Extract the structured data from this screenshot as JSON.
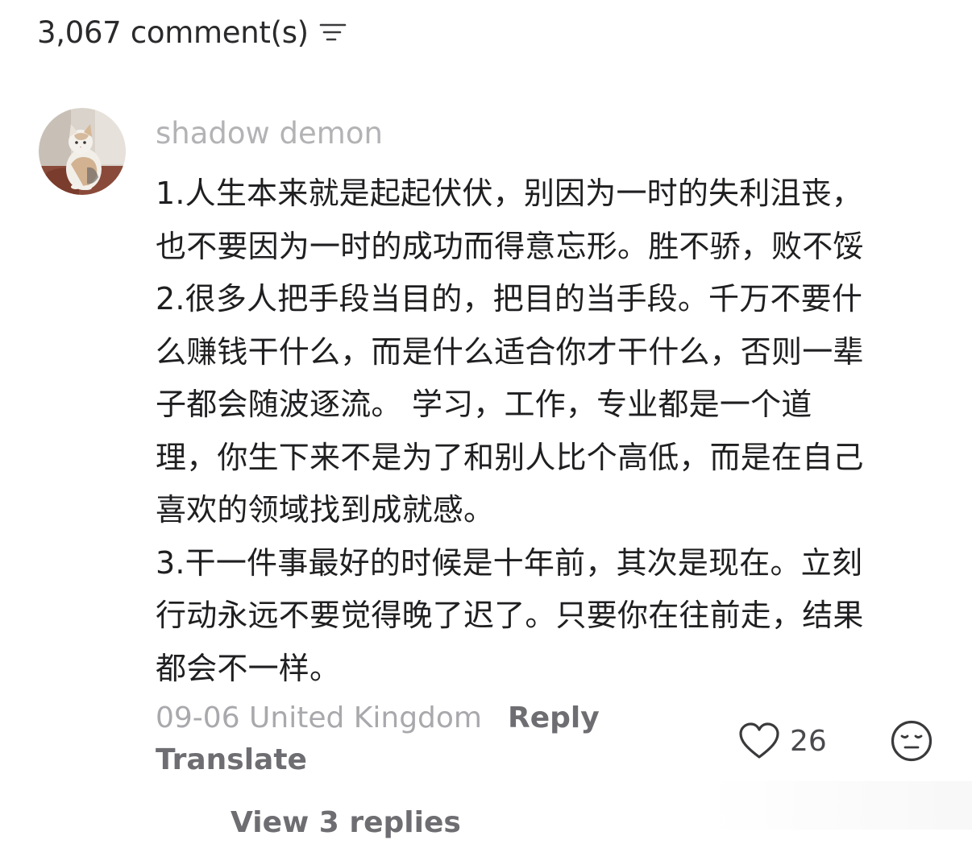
{
  "header": {
    "comment_count": "3,067 comment(s)",
    "sort_icon": "sort-lines-icon"
  },
  "comment": {
    "avatar_icon": "cat-avatar",
    "username": "shadow demon",
    "lines": [
      "1.人生本来就是起起伏伏，别因为一时的失利沮丧，",
      "也不要因为一时的成功而得意忘形。胜不骄，败不馁",
      "2.很多人把手段当目的，把目的当手段。千万不要什",
      "么赚钱干什么，而是什么适合你才干什么，否则一辈",
      "子都会随波逐流。 学习，工作，专业都是一个道",
      "理，你生下来不是为了和别人比个高低，而是在自己",
      "喜欢的领域找到成就感。",
      "3.干一件事最好的时候是十年前，其次是现在。立刻",
      "行动永远不要觉得晚了迟了。只要你在往前走，结果",
      "都会不一样。"
    ],
    "date_location": "09-06 United Kingdom",
    "reply_label": "Reply",
    "translate_label": "Translate",
    "like_count": "26",
    "like_icon": "heart-outline-icon",
    "dislike_icon": "meh-face-icon"
  },
  "replies": {
    "view_label": "View 3 replies"
  },
  "colors": {
    "username": "#b3b3b6",
    "meta": "#a9a9ad",
    "action": "#6e6e72",
    "text": "#1f1f21"
  }
}
